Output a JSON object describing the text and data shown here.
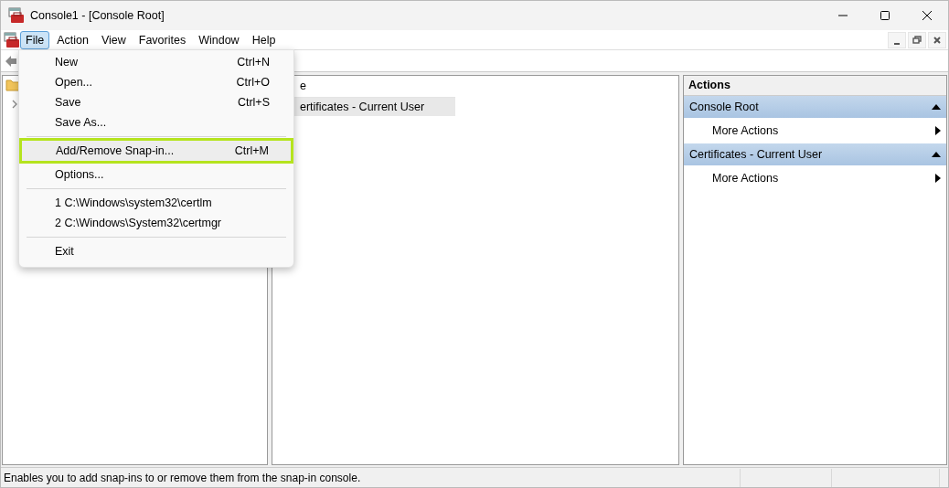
{
  "window": {
    "title": "Console1 - [Console Root]"
  },
  "menu_bar": [
    {
      "label": "File",
      "selected": true
    },
    {
      "label": "Action",
      "selected": false
    },
    {
      "label": "View",
      "selected": false
    },
    {
      "label": "Favorites",
      "selected": false
    },
    {
      "label": "Window",
      "selected": false
    },
    {
      "label": "Help",
      "selected": false
    }
  ],
  "file_menu": [
    {
      "kind": "item",
      "label": "New",
      "shortcut": "Ctrl+N",
      "selected": false
    },
    {
      "kind": "item",
      "label": "Open...",
      "shortcut": "Ctrl+O",
      "selected": false
    },
    {
      "kind": "item",
      "label": "Save",
      "shortcut": "Ctrl+S",
      "selected": false
    },
    {
      "kind": "item",
      "label": "Save As...",
      "selected": false
    },
    {
      "kind": "separator"
    },
    {
      "kind": "item",
      "label": "Add/Remove Snap-in...",
      "shortcut": "Ctrl+M",
      "selected": true
    },
    {
      "kind": "item",
      "label": "Options...",
      "selected": false
    },
    {
      "kind": "separator"
    },
    {
      "kind": "item",
      "label": "1 C:\\Windows\\system32\\certlm",
      "selected": false
    },
    {
      "kind": "item",
      "label": "2 C:\\Windows\\System32\\certmgr",
      "selected": false
    },
    {
      "kind": "separator"
    },
    {
      "kind": "item",
      "label": "Exit",
      "selected": false
    }
  ],
  "middle_pane": {
    "column_header": "e",
    "rows": [
      {
        "label": "ertificates - Current User",
        "selected": true
      }
    ]
  },
  "actions": {
    "title": "Actions",
    "groups": [
      {
        "title": "Console Root",
        "expanded": true,
        "items": [
          "More Actions"
        ]
      },
      {
        "title": "Certificates - Current User",
        "expanded": true,
        "items": [
          "More Actions"
        ]
      }
    ]
  },
  "status_bar": {
    "text": "Enables you to add snap-ins to or remove them from the snap-in console."
  }
}
